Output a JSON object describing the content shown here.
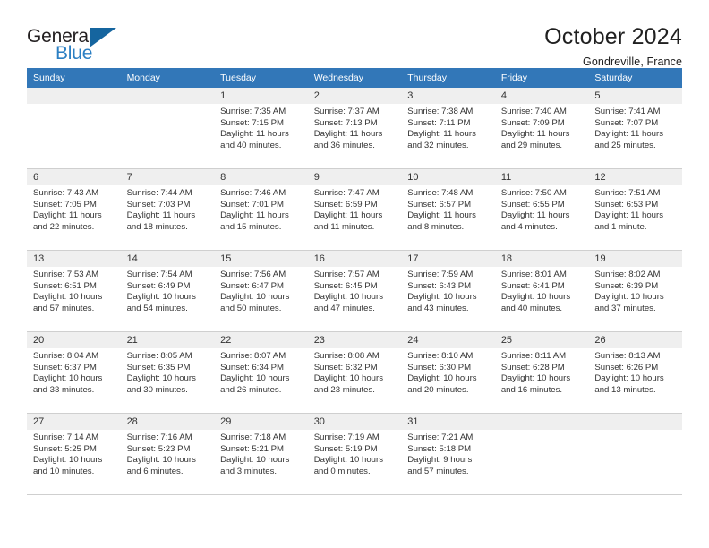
{
  "logo": {
    "word_top": "General",
    "word_bottom": "Blue",
    "triangle_color": "#15659f",
    "blue_color": "#2b7fc3"
  },
  "header": {
    "title": "October 2024",
    "subtitle": "Gondreville, France"
  },
  "theme": {
    "header_blue": "#3277b8",
    "date_band_gray": "#efefef",
    "grid_line": "#cfcfcf",
    "text": "#333333"
  },
  "weekday_headers": [
    "Sunday",
    "Monday",
    "Tuesday",
    "Wednesday",
    "Thursday",
    "Friday",
    "Saturday"
  ],
  "labels": {
    "sunrise_prefix": "Sunrise:",
    "sunset_prefix": "Sunset:",
    "daylight_prefix": "Daylight:"
  },
  "weeks": [
    [
      {
        "date": "",
        "empty": true
      },
      {
        "date": "",
        "empty": true
      },
      {
        "date": "1",
        "sunrise": "Sunrise: 7:35 AM",
        "sunset": "Sunset: 7:15 PM",
        "daylight_line1": "Daylight: 11 hours",
        "daylight_line2": "and 40 minutes."
      },
      {
        "date": "2",
        "sunrise": "Sunrise: 7:37 AM",
        "sunset": "Sunset: 7:13 PM",
        "daylight_line1": "Daylight: 11 hours",
        "daylight_line2": "and 36 minutes."
      },
      {
        "date": "3",
        "sunrise": "Sunrise: 7:38 AM",
        "sunset": "Sunset: 7:11 PM",
        "daylight_line1": "Daylight: 11 hours",
        "daylight_line2": "and 32 minutes."
      },
      {
        "date": "4",
        "sunrise": "Sunrise: 7:40 AM",
        "sunset": "Sunset: 7:09 PM",
        "daylight_line1": "Daylight: 11 hours",
        "daylight_line2": "and 29 minutes."
      },
      {
        "date": "5",
        "sunrise": "Sunrise: 7:41 AM",
        "sunset": "Sunset: 7:07 PM",
        "daylight_line1": "Daylight: 11 hours",
        "daylight_line2": "and 25 minutes."
      }
    ],
    [
      {
        "date": "6",
        "sunrise": "Sunrise: 7:43 AM",
        "sunset": "Sunset: 7:05 PM",
        "daylight_line1": "Daylight: 11 hours",
        "daylight_line2": "and 22 minutes."
      },
      {
        "date": "7",
        "sunrise": "Sunrise: 7:44 AM",
        "sunset": "Sunset: 7:03 PM",
        "daylight_line1": "Daylight: 11 hours",
        "daylight_line2": "and 18 minutes."
      },
      {
        "date": "8",
        "sunrise": "Sunrise: 7:46 AM",
        "sunset": "Sunset: 7:01 PM",
        "daylight_line1": "Daylight: 11 hours",
        "daylight_line2": "and 15 minutes."
      },
      {
        "date": "9",
        "sunrise": "Sunrise: 7:47 AM",
        "sunset": "Sunset: 6:59 PM",
        "daylight_line1": "Daylight: 11 hours",
        "daylight_line2": "and 11 minutes."
      },
      {
        "date": "10",
        "sunrise": "Sunrise: 7:48 AM",
        "sunset": "Sunset: 6:57 PM",
        "daylight_line1": "Daylight: 11 hours",
        "daylight_line2": "and 8 minutes."
      },
      {
        "date": "11",
        "sunrise": "Sunrise: 7:50 AM",
        "sunset": "Sunset: 6:55 PM",
        "daylight_line1": "Daylight: 11 hours",
        "daylight_line2": "and 4 minutes."
      },
      {
        "date": "12",
        "sunrise": "Sunrise: 7:51 AM",
        "sunset": "Sunset: 6:53 PM",
        "daylight_line1": "Daylight: 11 hours",
        "daylight_line2": "and 1 minute."
      }
    ],
    [
      {
        "date": "13",
        "sunrise": "Sunrise: 7:53 AM",
        "sunset": "Sunset: 6:51 PM",
        "daylight_line1": "Daylight: 10 hours",
        "daylight_line2": "and 57 minutes."
      },
      {
        "date": "14",
        "sunrise": "Sunrise: 7:54 AM",
        "sunset": "Sunset: 6:49 PM",
        "daylight_line1": "Daylight: 10 hours",
        "daylight_line2": "and 54 minutes."
      },
      {
        "date": "15",
        "sunrise": "Sunrise: 7:56 AM",
        "sunset": "Sunset: 6:47 PM",
        "daylight_line1": "Daylight: 10 hours",
        "daylight_line2": "and 50 minutes."
      },
      {
        "date": "16",
        "sunrise": "Sunrise: 7:57 AM",
        "sunset": "Sunset: 6:45 PM",
        "daylight_line1": "Daylight: 10 hours",
        "daylight_line2": "and 47 minutes."
      },
      {
        "date": "17",
        "sunrise": "Sunrise: 7:59 AM",
        "sunset": "Sunset: 6:43 PM",
        "daylight_line1": "Daylight: 10 hours",
        "daylight_line2": "and 43 minutes."
      },
      {
        "date": "18",
        "sunrise": "Sunrise: 8:01 AM",
        "sunset": "Sunset: 6:41 PM",
        "daylight_line1": "Daylight: 10 hours",
        "daylight_line2": "and 40 minutes."
      },
      {
        "date": "19",
        "sunrise": "Sunrise: 8:02 AM",
        "sunset": "Sunset: 6:39 PM",
        "daylight_line1": "Daylight: 10 hours",
        "daylight_line2": "and 37 minutes."
      }
    ],
    [
      {
        "date": "20",
        "sunrise": "Sunrise: 8:04 AM",
        "sunset": "Sunset: 6:37 PM",
        "daylight_line1": "Daylight: 10 hours",
        "daylight_line2": "and 33 minutes."
      },
      {
        "date": "21",
        "sunrise": "Sunrise: 8:05 AM",
        "sunset": "Sunset: 6:35 PM",
        "daylight_line1": "Daylight: 10 hours",
        "daylight_line2": "and 30 minutes."
      },
      {
        "date": "22",
        "sunrise": "Sunrise: 8:07 AM",
        "sunset": "Sunset: 6:34 PM",
        "daylight_line1": "Daylight: 10 hours",
        "daylight_line2": "and 26 minutes."
      },
      {
        "date": "23",
        "sunrise": "Sunrise: 8:08 AM",
        "sunset": "Sunset: 6:32 PM",
        "daylight_line1": "Daylight: 10 hours",
        "daylight_line2": "and 23 minutes."
      },
      {
        "date": "24",
        "sunrise": "Sunrise: 8:10 AM",
        "sunset": "Sunset: 6:30 PM",
        "daylight_line1": "Daylight: 10 hours",
        "daylight_line2": "and 20 minutes."
      },
      {
        "date": "25",
        "sunrise": "Sunrise: 8:11 AM",
        "sunset": "Sunset: 6:28 PM",
        "daylight_line1": "Daylight: 10 hours",
        "daylight_line2": "and 16 minutes."
      },
      {
        "date": "26",
        "sunrise": "Sunrise: 8:13 AM",
        "sunset": "Sunset: 6:26 PM",
        "daylight_line1": "Daylight: 10 hours",
        "daylight_line2": "and 13 minutes."
      }
    ],
    [
      {
        "date": "27",
        "sunrise": "Sunrise: 7:14 AM",
        "sunset": "Sunset: 5:25 PM",
        "daylight_line1": "Daylight: 10 hours",
        "daylight_line2": "and 10 minutes."
      },
      {
        "date": "28",
        "sunrise": "Sunrise: 7:16 AM",
        "sunset": "Sunset: 5:23 PM",
        "daylight_line1": "Daylight: 10 hours",
        "daylight_line2": "and 6 minutes."
      },
      {
        "date": "29",
        "sunrise": "Sunrise: 7:18 AM",
        "sunset": "Sunset: 5:21 PM",
        "daylight_line1": "Daylight: 10 hours",
        "daylight_line2": "and 3 minutes."
      },
      {
        "date": "30",
        "sunrise": "Sunrise: 7:19 AM",
        "sunset": "Sunset: 5:19 PM",
        "daylight_line1": "Daylight: 10 hours",
        "daylight_line2": "and 0 minutes."
      },
      {
        "date": "31",
        "sunrise": "Sunrise: 7:21 AM",
        "sunset": "Sunset: 5:18 PM",
        "daylight_line1": "Daylight: 9 hours",
        "daylight_line2": "and 57 minutes."
      },
      {
        "date": "",
        "empty": true
      },
      {
        "date": "",
        "empty": true
      }
    ]
  ]
}
